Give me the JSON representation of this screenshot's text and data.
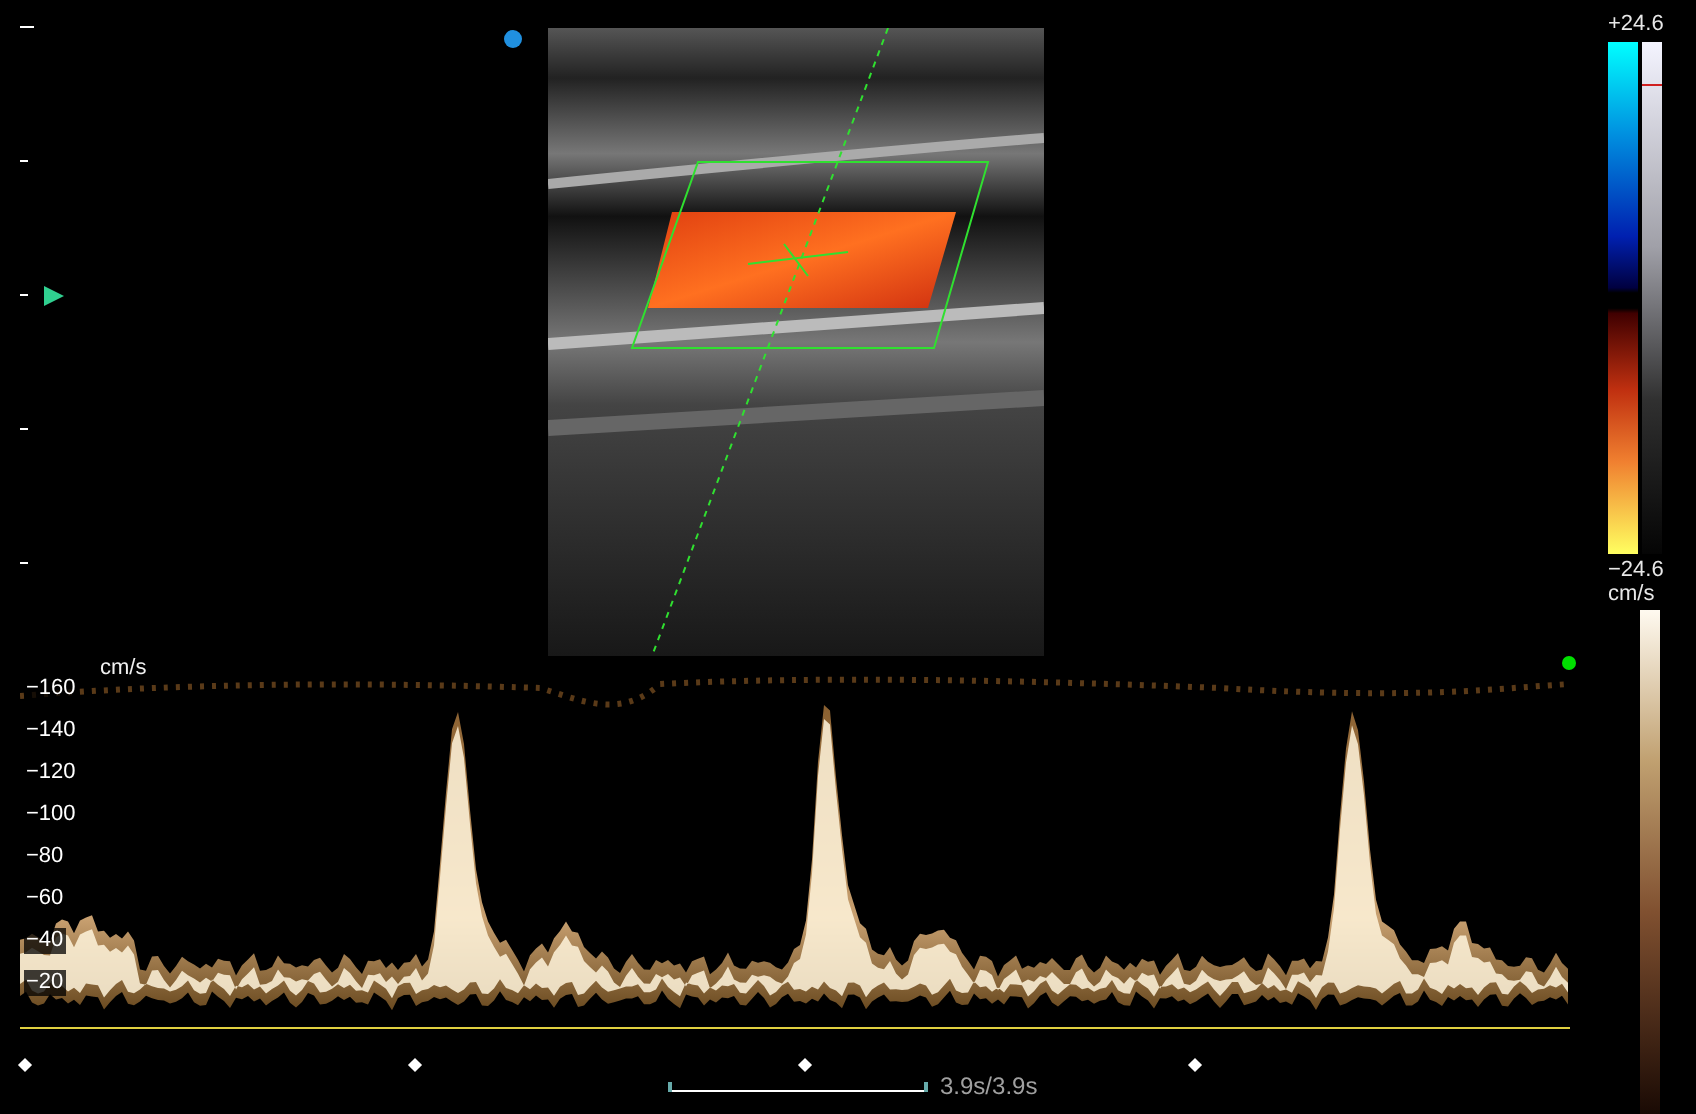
{
  "color_scale": {
    "max_label": "+24.6",
    "min_label": "−24.6",
    "unit": "cm/s"
  },
  "spectrum": {
    "unit": "cm/s",
    "y_labels": [
      "−160",
      "−140",
      "−120",
      "−100",
      "−80",
      "−60",
      "−40",
      "−20"
    ],
    "sweep": "3.9s/3.9s"
  }
}
